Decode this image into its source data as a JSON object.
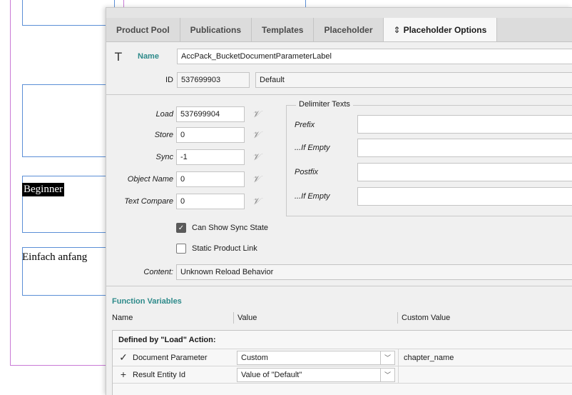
{
  "document": {
    "text_beginner": "Beginner",
    "text_einfach": "Einfach anfang"
  },
  "tabs": [
    {
      "label": "Product Pool"
    },
    {
      "label": "Publications"
    },
    {
      "label": "Templates"
    },
    {
      "label": "Placeholder"
    },
    {
      "label": "Placeholder Options",
      "active": true
    }
  ],
  "header": {
    "type_icon": "text-frame-icon",
    "name_label": "Name",
    "name_value": "AccPack_BucketDocumentParameterLabel",
    "id_label": "ID",
    "id_value": "537699903",
    "id_default": "Default"
  },
  "actions": {
    "load_label": "Load",
    "load_value": "537699904",
    "store_label": "Store",
    "store_value": "0",
    "sync_label": "Sync",
    "sync_value": "-1",
    "object_name_label": "Object Name",
    "object_name_value": "0",
    "text_compare_label": "Text Compare",
    "text_compare_value": "0"
  },
  "delimiter": {
    "title": "Delimiter Texts",
    "prefix_label": "Prefix",
    "if_empty_1_label": "...If Empty",
    "postfix_label": "Postfix",
    "if_empty_2_label": "...If Empty",
    "prefix_value": "",
    "if_empty_1_value": "",
    "postfix_value": "",
    "if_empty_2_value": ""
  },
  "options": {
    "can_show_sync_state": "Can Show Sync State",
    "can_show_sync_state_checked": true,
    "static_product_link": "Static Product Link",
    "static_product_link_checked": false,
    "checkmark": "✓",
    "content_label": "Content:",
    "content_value": "Unknown Reload Behavior"
  },
  "function_variables": {
    "title": "Function Variables",
    "col_name": "Name",
    "col_value": "Value",
    "col_custom": "Custom Value",
    "group_label": "Defined by \"Load\" Action:",
    "rows": [
      {
        "icon": "✓",
        "name": "Document Parameter",
        "value": "Custom",
        "custom": "chapter_name"
      },
      {
        "icon": "+",
        "name": "Result Entity Id",
        "value": "Value of \"Default\"",
        "custom": ""
      }
    ],
    "arrow": "﹀"
  },
  "colors": {
    "accent": "#2d8a8a",
    "frame": "#5b8fd6",
    "page_border": "#c97ad6"
  }
}
